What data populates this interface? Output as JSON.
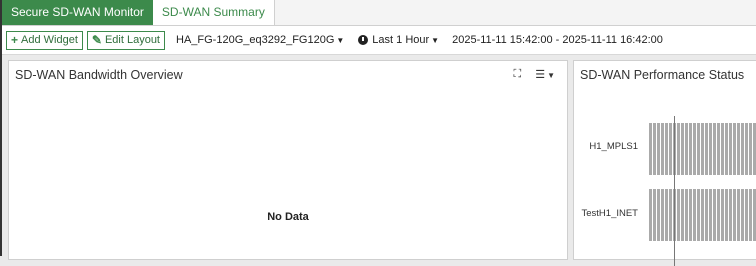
{
  "tabs": [
    {
      "label": "Secure SD-WAN Monitor",
      "active": true
    },
    {
      "label": "SD-WAN Summary",
      "active": false
    }
  ],
  "toolbar": {
    "add_widget": "Add Widget",
    "edit_layout": "Edit Layout",
    "device": "HA_FG-120G_eq3292_FG120G",
    "time_period": "Last 1 Hour",
    "time_range": "2025-11-11 15:42:00 - 2025-11-11 16:42:00"
  },
  "widgets": {
    "bandwidth": {
      "title": "SD-WAN Bandwidth Overview",
      "empty_text": "No Data"
    },
    "performance": {
      "title": "SD-WAN Performance Status",
      "rows": [
        "H1_MPLS1",
        "TestH1_INET"
      ]
    }
  },
  "colors": {
    "accent": "#3c8a4b",
    "bar": "#aaaaaa"
  }
}
